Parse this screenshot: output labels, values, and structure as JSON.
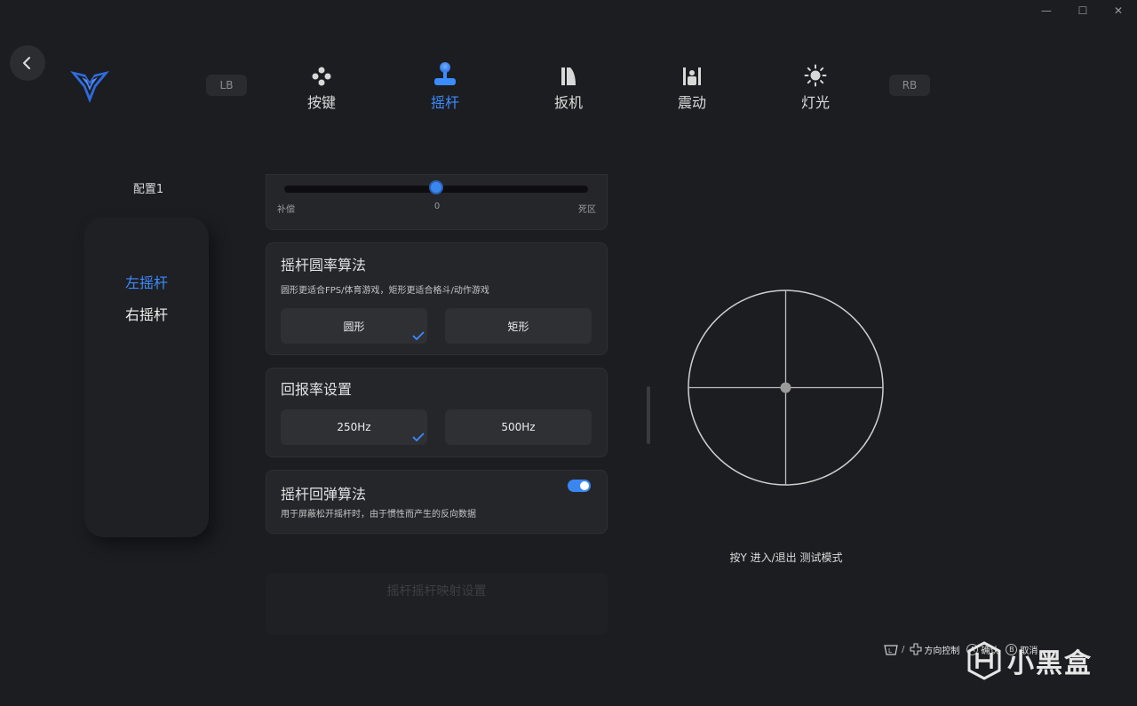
{
  "window": {
    "minimize_icon": "minimize-icon",
    "maximize_icon": "maximize-icon",
    "close_icon": "close-icon"
  },
  "header": {
    "back_icon": "chevron-left-icon",
    "logo": "flydigi-logo",
    "shoulder_left": "LB",
    "shoulder_right": "RB",
    "tabs": [
      {
        "label": "按键",
        "icon": "gamepad-buttons-icon",
        "active": false
      },
      {
        "label": "摇杆",
        "icon": "joystick-icon",
        "active": true
      },
      {
        "label": "扳机",
        "icon": "trigger-icon",
        "active": false
      },
      {
        "label": "震动",
        "icon": "vibration-icon",
        "active": false
      },
      {
        "label": "灯光",
        "icon": "light-icon",
        "active": false
      }
    ]
  },
  "sidebar": {
    "config_label": "配置1",
    "items": [
      {
        "label": "左摇杆",
        "active": true
      },
      {
        "label": "右摇杆",
        "active": false
      }
    ]
  },
  "slider_card": {
    "left_label": "补偿",
    "value_label": "0",
    "right_label": "死区",
    "value_fraction": 0.5
  },
  "roundness_card": {
    "title": "摇杆圆率算法",
    "description": "圆形更适合FPS/体育游戏，矩形更适合格斗/动作游戏",
    "options": [
      {
        "label": "圆形",
        "selected": true
      },
      {
        "label": "矩形",
        "selected": false
      }
    ]
  },
  "polling_card": {
    "title": "回报率设置",
    "options": [
      {
        "label": "250Hz",
        "selected": true
      },
      {
        "label": "500Hz",
        "selected": false
      }
    ]
  },
  "rebound_card": {
    "title": "摇杆回弹算法",
    "description": "用于屏蔽松开摇杆时，由于惯性而产生的反向数据",
    "enabled": true
  },
  "faded_card": {
    "text": "摇杆摇杆映射设置"
  },
  "test_panel": {
    "hint": "按Y 进入/退出 测试模式"
  },
  "footer": {
    "lb_rb_icon": "shoulder-buttons-icon",
    "separator": "/",
    "dpad_icon": "dpad-icon",
    "dpad_label": "方向控制",
    "a_key": "A",
    "a_label": "确认",
    "b_key": "B",
    "b_label": "取消"
  },
  "watermark": {
    "text": "小黑盒",
    "icon": "heybox-logo-icon"
  },
  "colors": {
    "background": "#1c1d20",
    "card": "#25262a",
    "accent": "#3b8cff",
    "button": "#2f3034"
  }
}
